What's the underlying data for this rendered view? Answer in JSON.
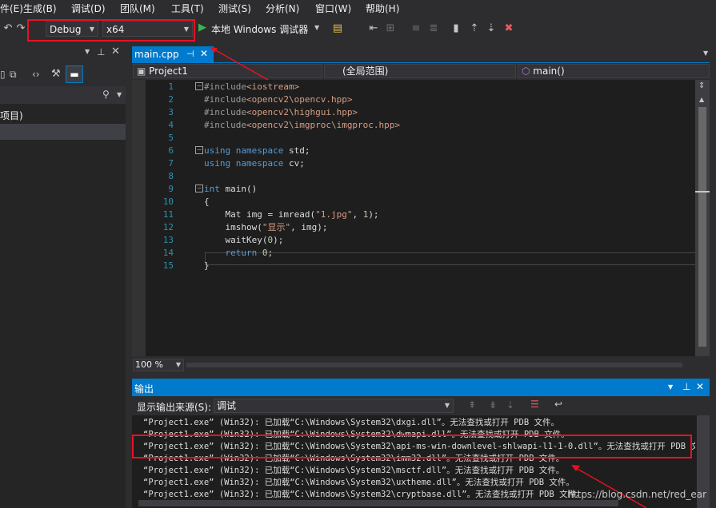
{
  "menu": [
    "生成(B)",
    "调试(D)",
    "团队(M)",
    "工具(T)",
    "测试(S)",
    "分析(N)",
    "窗口(W)",
    "帮助(H)"
  ],
  "menu_left_partial": "件(E)",
  "toolbar": {
    "config": "Debug",
    "platform": "x64",
    "run_label": "本地 Windows 调试器"
  },
  "left_panel": {
    "partial_item": "项目)"
  },
  "editor": {
    "tab": "main.cpp",
    "nav_project": "Project1",
    "nav_scope": "(全局范围)",
    "nav_member": "main()",
    "zoom": "100 %",
    "lines": [
      {
        "n": "1",
        "parts": [
          [
            "pp",
            "#include"
          ],
          [
            "inc",
            "<iostream>"
          ]
        ]
      },
      {
        "n": "2",
        "parts": [
          [
            "pp",
            "#include"
          ],
          [
            "inc",
            "<opencv2\\opencv.hpp>"
          ]
        ]
      },
      {
        "n": "3",
        "parts": [
          [
            "pp",
            "#include"
          ],
          [
            "inc",
            "<opencv2\\highgui.hpp>"
          ]
        ]
      },
      {
        "n": "4",
        "parts": [
          [
            "pp",
            "#include"
          ],
          [
            "inc",
            "<opencv2\\imgproc\\imgproc.hpp>"
          ]
        ]
      },
      {
        "n": "5",
        "parts": []
      },
      {
        "n": "6",
        "parts": [
          [
            "kw",
            "using"
          ],
          [
            "fn",
            " "
          ],
          [
            "kw",
            "namespace"
          ],
          [
            "fn",
            " std;"
          ]
        ]
      },
      {
        "n": "7",
        "parts": [
          [
            "kw",
            "using"
          ],
          [
            "fn",
            " "
          ],
          [
            "kw",
            "namespace"
          ],
          [
            "fn",
            " cv;"
          ]
        ]
      },
      {
        "n": "8",
        "parts": []
      },
      {
        "n": "9",
        "parts": [
          [
            "kw",
            "int"
          ],
          [
            "fn",
            " main()"
          ]
        ]
      },
      {
        "n": "10",
        "parts": [
          [
            "fn",
            "{"
          ]
        ]
      },
      {
        "n": "11",
        "parts": [
          [
            "fn",
            "    Mat img = imread("
          ],
          [
            "str",
            "\"1.jpg\""
          ],
          [
            "fn",
            ", "
          ],
          [
            "num",
            "1"
          ],
          [
            "fn",
            ");"
          ]
        ]
      },
      {
        "n": "12",
        "parts": [
          [
            "fn",
            "    imshow("
          ],
          [
            "str",
            "\"显示\""
          ],
          [
            "fn",
            ", img);"
          ]
        ]
      },
      {
        "n": "13",
        "parts": [
          [
            "fn",
            "    waitKey("
          ],
          [
            "num",
            "0"
          ],
          [
            "fn",
            ");"
          ]
        ]
      },
      {
        "n": "14",
        "parts": [
          [
            "fn",
            "    "
          ],
          [
            "kw",
            "return"
          ],
          [
            "fn",
            " "
          ],
          [
            "num",
            "0"
          ],
          [
            "fn",
            ";"
          ]
        ]
      },
      {
        "n": "15",
        "parts": [
          [
            "fn",
            "}"
          ]
        ]
      }
    ]
  },
  "output": {
    "title": "输出",
    "source_label": "显示输出来源(S):",
    "source_value": "调试",
    "lines": [
      "“Project1.exe” (Win32): 已加载“C:\\Windows\\System32\\dxgi.dll”。无法查找或打开 PDB 文件。",
      "“Project1.exe” (Win32): 已加载“C:\\Windows\\System32\\dwmapi.dll”。无法查找或打开 PDB 文件。",
      "“Project1.exe” (Win32): 已加载“C:\\Windows\\System32\\api-ms-win-downlevel-shlwapi-l1-1-0.dll”。无法查找或打开 PDB 文",
      "“Project1.exe” (Win32): 已加载“C:\\Windows\\System32\\imm32.dll”。无法查找或打开 PDB 文件。",
      "“Project1.exe” (Win32): 已加载“C:\\Windows\\System32\\msctf.dll”。无法查找或打开 PDB 文件。",
      "“Project1.exe” (Win32): 已加载“C:\\Windows\\System32\\uxtheme.dll”。无法查找或打开 PDB 文件。",
      "“Project1.exe” (Win32): 已加载“C:\\Windows\\System32\\cryptbase.dll”。无法查找或打开 PDB 文件。"
    ]
  },
  "watermark": "https://blog.csdn.net/red_ear",
  "colors": {
    "accent": "#007acc",
    "highlight": "#e81123",
    "background": "#2d2d30"
  }
}
